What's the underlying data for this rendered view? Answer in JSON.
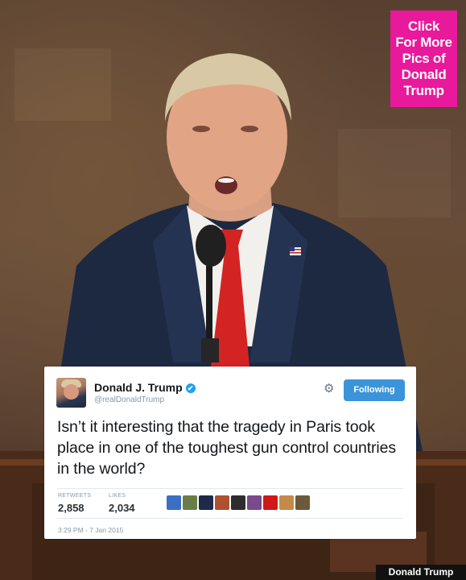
{
  "promo": {
    "lines": [
      "Click",
      "For More",
      "Pics of",
      "Donald",
      "Trump"
    ]
  },
  "tweet": {
    "name": "Donald J. Trump",
    "verified": "✔",
    "handle": "@realDonaldTrump",
    "follow_label": "Following",
    "text": "Isn’t it interesting that the tragedy in Paris took place in one of the toughest gun control countries in the world?",
    "retweets_label": "RETWEETS",
    "retweets": "2,858",
    "likes_label": "LIKES",
    "likes": "2,034",
    "timestamp": "3:29 PM - 7 Jan 2015",
    "liker_colors": [
      "#3a6fc4",
      "#6a7d48",
      "#1e2a4a",
      "#b05030",
      "#2d2d2d",
      "#7a4a8a",
      "#d01818",
      "#c58a4a",
      "#6b5a3a"
    ]
  },
  "caption": "Donald Trump",
  "colors": {
    "promo_bg": "#e8199a",
    "follow_button": "#3b94d9",
    "verified_badge": "#1da1f2"
  }
}
